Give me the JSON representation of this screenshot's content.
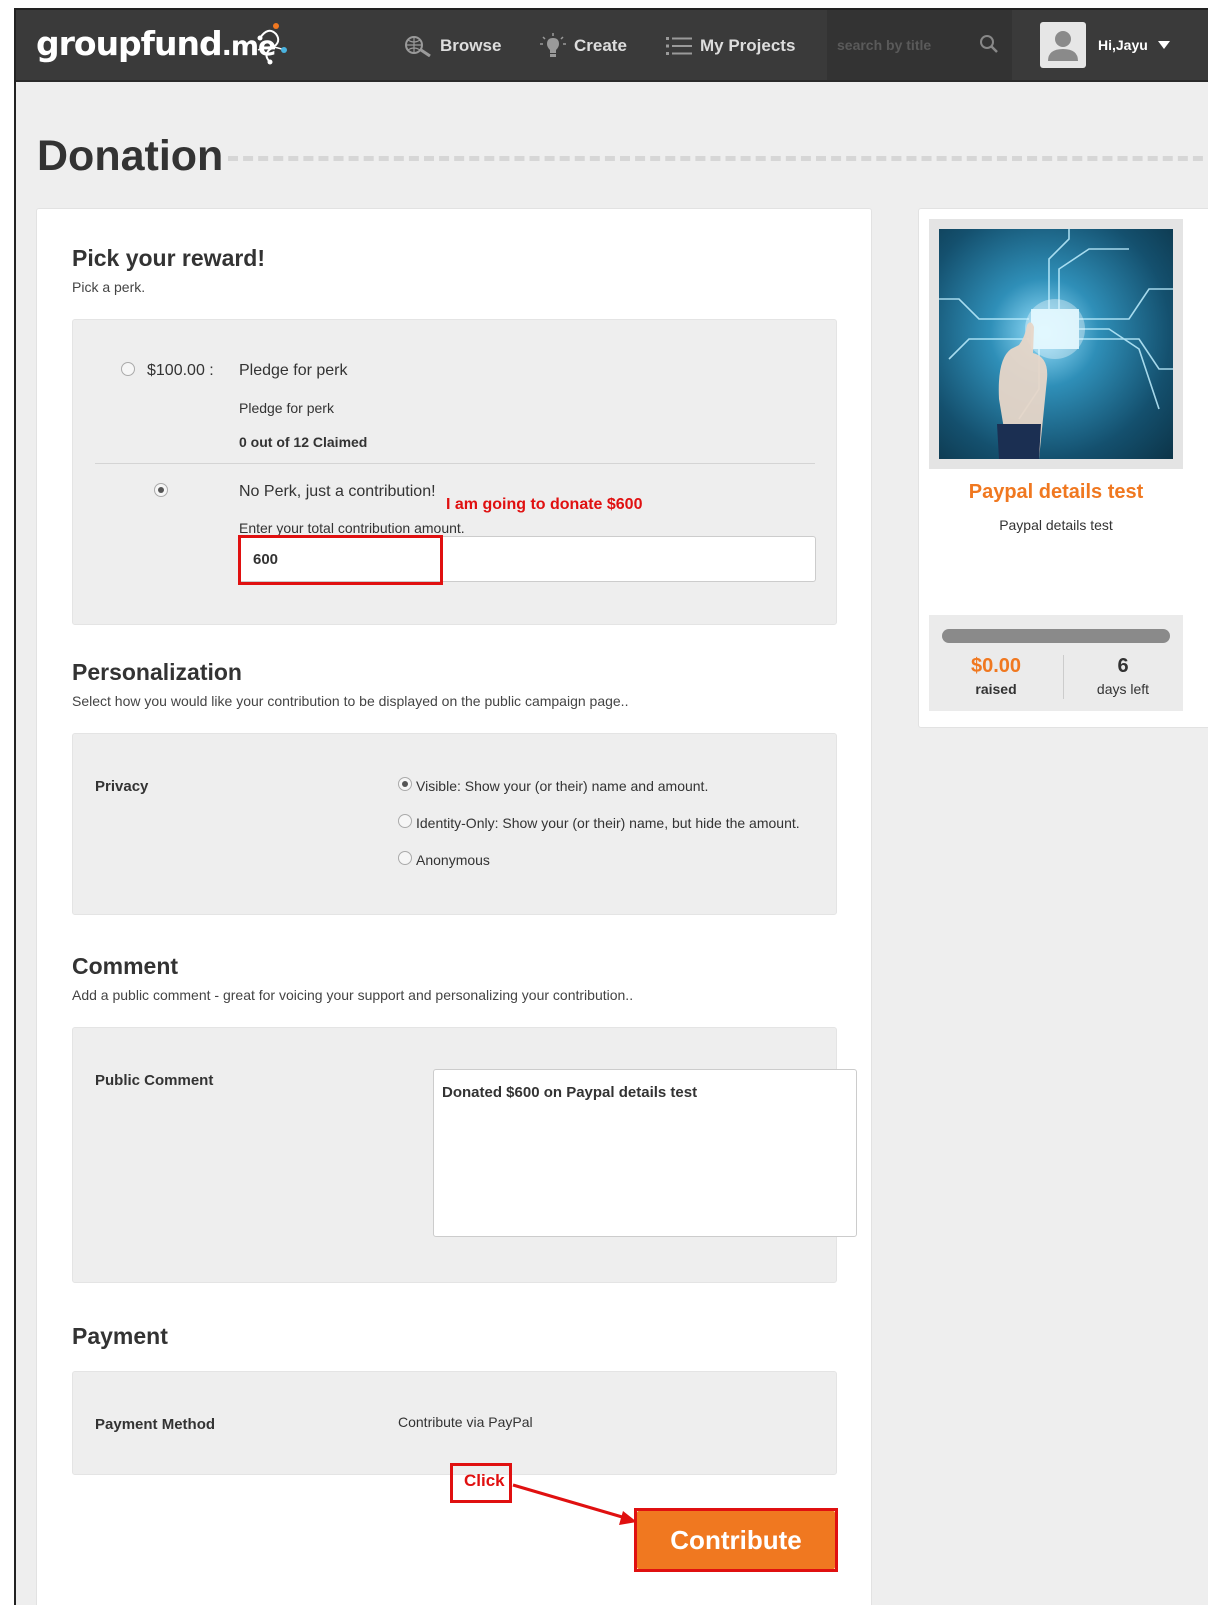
{
  "nav": {
    "logo": "groupfund",
    "logo_suffix": ".me",
    "browse": "Browse",
    "create": "Create",
    "my_projects": "My Projects",
    "search_placeholder": "search by title",
    "user_greeting": "Hi,Jayu"
  },
  "page": {
    "title": "Donation"
  },
  "reward": {
    "title": "Pick your reward!",
    "subtitle": "Pick a perk.",
    "perk": {
      "price": "$100.00 :",
      "name": "Pledge for perk",
      "description": "Pledge for perk",
      "claimed": "0 out of 12 Claimed"
    },
    "no_perk": {
      "label": "No Perk, just a contribution!",
      "amount_label": "Enter your total contribution amount.",
      "amount_value": "600"
    }
  },
  "personalization": {
    "title": "Personalization",
    "subtitle": "Select how you would like your contribution to be displayed on the public campaign page..",
    "privacy_label": "Privacy",
    "options": [
      "Visible: Show your (or their) name and amount.",
      "Identity-Only: Show your (or their) name, but hide the amount.",
      "Anonymous"
    ]
  },
  "comment": {
    "title": "Comment",
    "subtitle": "Add a public comment - great for voicing your support and personalizing your contribution..",
    "label": "Public Comment",
    "value": "Donated $600 on Paypal details test"
  },
  "payment": {
    "title": "Payment",
    "method_label": "Payment Method",
    "method_value": "Contribute via PayPal",
    "button": "Contribute"
  },
  "annotations": {
    "donate_note": "I am going to donate $600",
    "click_note": "Click",
    "color": "#e01010"
  },
  "campaign": {
    "title": "Paypal details test",
    "subtitle": "Paypal details test",
    "raised_amount": "$0.00",
    "raised_label": "raised",
    "days_value": "6",
    "days_label": "days left",
    "accent": "#f07820"
  }
}
